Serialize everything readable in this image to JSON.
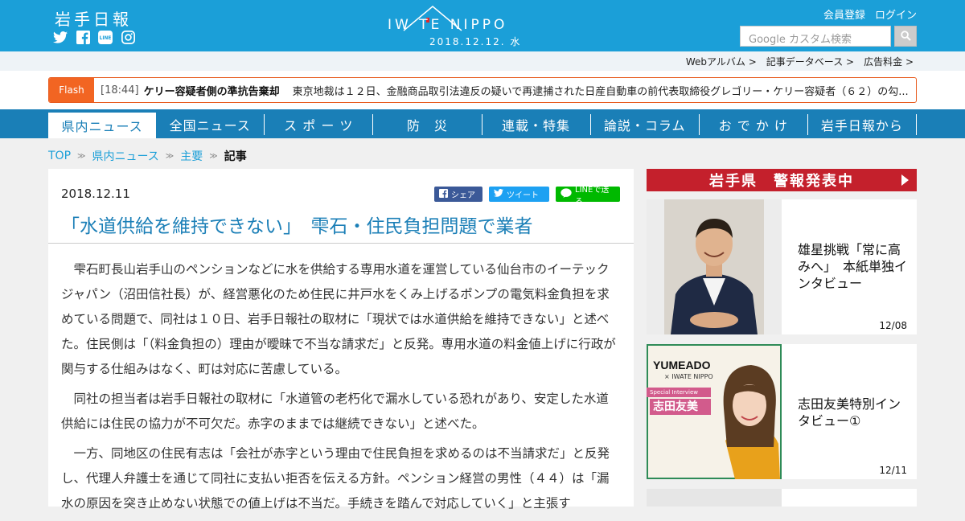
{
  "header": {
    "logo_jp": "岩手日報",
    "brand": "IW  TE NIPPO",
    "brand_date": "2018.12.12. 水",
    "account": [
      "会員登録",
      "ログイン"
    ],
    "search_placeholder": "Google カスタム検索",
    "social_icons": [
      "twitter-icon",
      "facebook-icon",
      "line-icon",
      "instagram-icon"
    ]
  },
  "subbar": {
    "links": [
      "Webアルバム",
      "記事データベース",
      "広告料金"
    ]
  },
  "flash": {
    "label": "Flash",
    "time": "[18:44]",
    "title": "ケリー容疑者側の準抗告棄却",
    "text": "東京地裁は１２日、金融商品取引法違反の疑いで再逮捕された日産自動車の前代表取締役グレゴリー・ケリー容疑者（６２）の勾..."
  },
  "nav": {
    "items": [
      "県内ニュース",
      "全国ニュース",
      "ス ポ ー ツ",
      "防　災",
      "連載・特集",
      "論説・コラム",
      "お で か け",
      "岩手日報から"
    ],
    "active_index": 0
  },
  "breadcrumb": {
    "items": [
      "TOP",
      "県内ニュース",
      "主要"
    ],
    "current": "記事"
  },
  "article": {
    "date": "2018.12.11",
    "share": {
      "facebook": "シェア",
      "twitter": "ツイート",
      "line": "LINEで送る"
    },
    "title": "「水道供給を維持できない」　雫石・住民負担問題で業者",
    "paragraphs": [
      "雫石町長山岩手山のペンションなどに水を供給する専用水道を運営している仙台市のイーテックジャパン（沼田信社長）が、経営悪化のため住民に井戸水をくみ上げるポンプの電気料金負担を求めている問題で、同社は１０日、岩手日報社の取材に「現状では水道供給を維持できない」と述べた。住民側は「（料金負担の）理由が曖昧で不当な請求だ」と反発。専用水道の料金値上げに行政が関与する仕組みはなく、町は対応に苦慮している。",
      "同社の担当者は岩手日報社の取材に「水道管の老朽化で漏水している恐れがあり、安定した水道供給には住民の協力が不可欠だ。赤字のままでは継続できない」と述べた。",
      "一方、同地区の住民有志は「会社が赤字という理由で住民負担を求めるのは不当請求だ」と反発し、代理人弁護士を通じて同社に支払い拒否を伝える方針。ペンション経営の男性（４４）は「漏水の原因を突き止めない状態での値上げは不当だ。手続きを踏んで対応していく」と主張す"
    ]
  },
  "sidebar": {
    "alert": "岩手県　警報発表中",
    "cards": [
      {
        "title": "雄星挑戦「常に高みへ」　本紙単独インタビュー",
        "date": "12/08"
      },
      {
        "title": "志田友美特別インタビュー①",
        "date": "12/11",
        "thumb_brand": "YUMEADO",
        "thumb_sub": "× IWATE NIPPO",
        "thumb_tag": "Special Interview",
        "thumb_name": "志田友美"
      }
    ]
  },
  "colors": {
    "header": "#1b9fd8",
    "nav": "#1a7fb7",
    "flash": "#f26522",
    "alert": "#c4202c",
    "title": "#1b7fb7"
  }
}
